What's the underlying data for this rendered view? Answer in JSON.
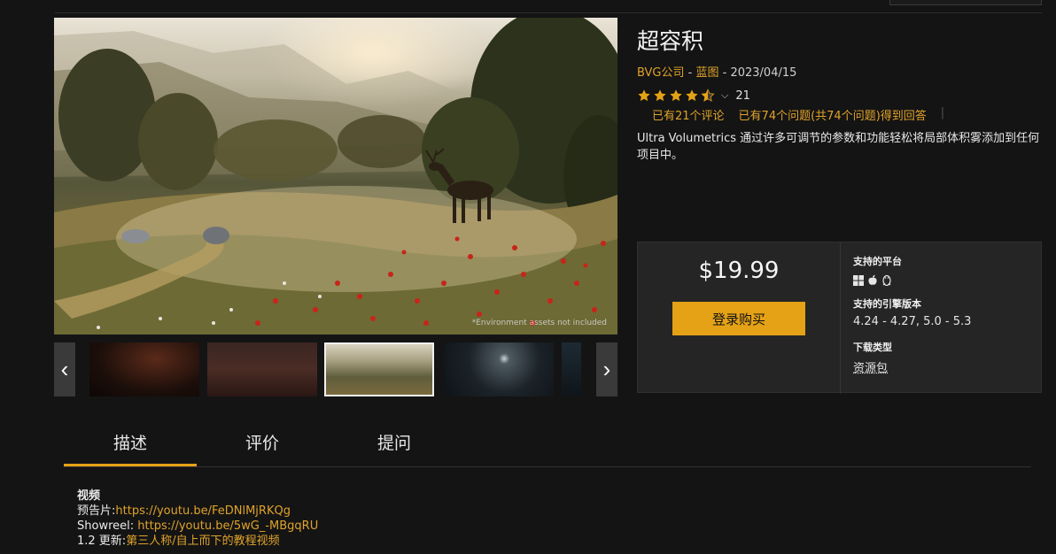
{
  "product": {
    "title": "超容积",
    "publisher": "BVG公司",
    "separator": " - ",
    "category": "蓝图",
    "date": "2023/04/15",
    "rating_value": 4.5,
    "rating_count": "21",
    "reviews_link": "已有21个评论",
    "questions_link": "已有74个问题(共74个问题)得到回答",
    "description": "Ultra Volumetrics 通过许多可调节的参数和功能轻松将局部体积雾添加到任何项目中。"
  },
  "media": {
    "hero_note": "*Environment assets not included",
    "thumbnail_count": 5,
    "selected_thumbnail": 3
  },
  "purchase": {
    "price": "$19.99",
    "buy_label": "登录购买",
    "platforms_label": "支持的平台",
    "platform_icons": [
      "windows-icon",
      "apple-icon",
      "linux-icon"
    ],
    "engine_label": "支持的引擎版本",
    "engine_versions": "4.24 - 4.27, 5.0 - 5.3",
    "download_label": "下载类型",
    "download_type": "资源包"
  },
  "tabs": [
    {
      "label": "描述",
      "active": true
    },
    {
      "label": "评价",
      "active": false
    },
    {
      "label": "提问",
      "active": false
    }
  ],
  "body": {
    "heading": "视频",
    "trailer_label": "预告片:",
    "trailer_url": "https://youtu.be/FeDNlMjRKQg",
    "showreel_label": "Showreel: ",
    "showreel_url": "https://youtu.be/5wG_-MBgqRU",
    "update_label": "1.2 更新:",
    "update_link": "第三人称/自上而下的教程视频"
  },
  "colors": {
    "accent": "#e5a216",
    "link": "#e0a32a",
    "background": "#141414",
    "panel": "#252525"
  }
}
